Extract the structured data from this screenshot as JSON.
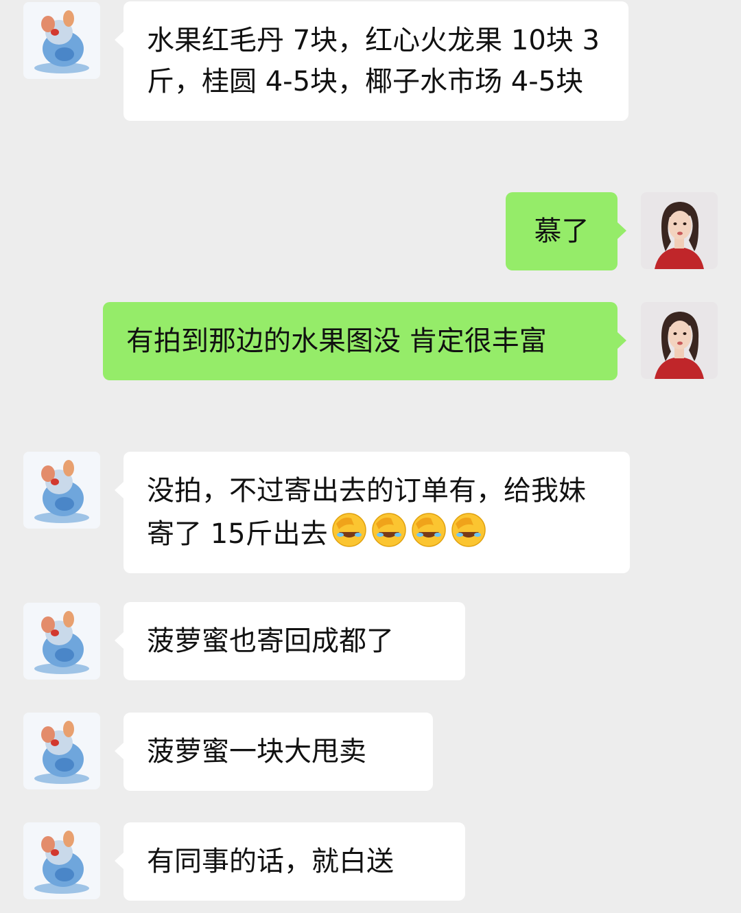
{
  "messages": [
    {
      "side": "left",
      "text": "水果红毛丹 7块，红心火龙果 10块 3斤，桂圆 4-5块，椰子水市场 4-5块"
    },
    {
      "side": "right",
      "text": "慕了"
    },
    {
      "side": "right",
      "text": "有拍到那边的水果图没 肯定很丰富"
    },
    {
      "side": "left",
      "text": "没拍，不过寄出去的订单有，给我妹寄了 15斤出去",
      "emoji": "facepalm-laugh-icon",
      "emoji_count": 4
    },
    {
      "side": "left",
      "text": "菠萝蜜也寄回成都了"
    },
    {
      "side": "left",
      "text": "菠萝蜜一块大甩卖"
    },
    {
      "side": "left",
      "text": "有同事的话，就白送"
    }
  ],
  "colors": {
    "background": "#ededed",
    "left_bubble": "#ffffff",
    "right_bubble": "#95ec69",
    "text": "#111111"
  },
  "avatars": {
    "contact": "mouse-cartoon-avatar-icon",
    "self": "woman-portrait-avatar-icon"
  }
}
